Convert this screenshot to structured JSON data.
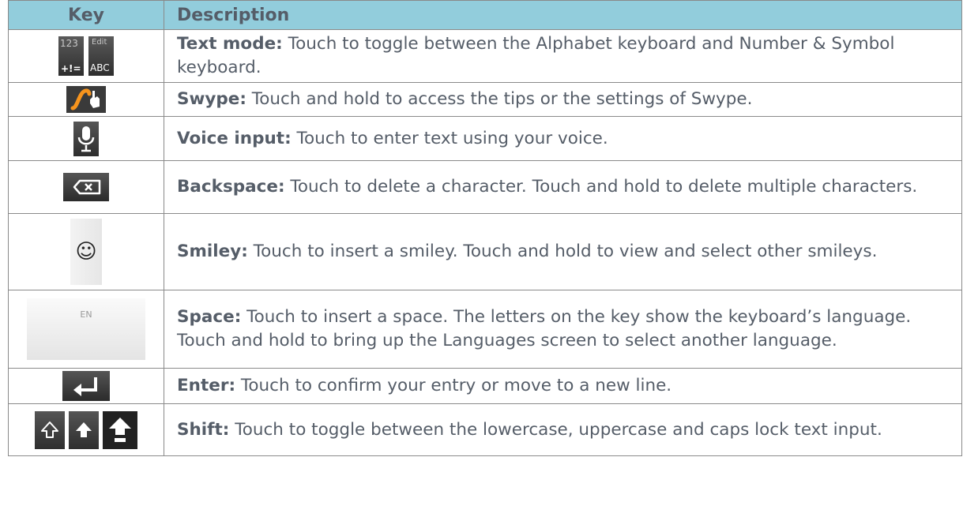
{
  "header": {
    "key": "Key",
    "description": "Description"
  },
  "rows": [
    {
      "term": "Text mode:",
      "text": " Touch to toggle between the Alphabet keyboard and Number & Symbol keyboard.",
      "icon": "text-mode-keys-icon",
      "key_labels": {
        "top_left": "123",
        "bottom_left": "+!=",
        "top_right": "Edit",
        "bottom_right": "ABC"
      }
    },
    {
      "term": "Swype:",
      "text": " Touch and hold to access the tips or the settings of Swype.",
      "icon": "swype-icon"
    },
    {
      "term": "Voice input:",
      "text": " Touch to enter text using your voice.",
      "icon": "microphone-icon"
    },
    {
      "term": "Backspace:",
      "text": " Touch to delete a character. Touch and hold to delete multiple characters.",
      "icon": "backspace-icon"
    },
    {
      "term": "Smiley:",
      "text": " Touch to insert a smiley. Touch and hold to view and select other smileys.",
      "icon": "smiley-icon",
      "glyph": "☺"
    },
    {
      "term": "Space:",
      "text": " Touch to insert a space. The letters on the key show the keyboard’s language. Touch and hold to bring up the Languages screen to select another language.",
      "icon": "space-key-icon",
      "key_label": "EN"
    },
    {
      "term": "Enter:",
      "text": " Touch to confirm your entry or move to a new line.",
      "icon": "enter-icon"
    },
    {
      "term": "Shift:",
      "text": " Touch to toggle between the lowercase, uppercase and caps lock text input.",
      "icon": "shift-keys-icon"
    }
  ],
  "colors": {
    "header_bg": "#92cddc",
    "text": "#555d68",
    "key_dark": "#3a3a3a",
    "swype_orange": "#f7941d"
  }
}
